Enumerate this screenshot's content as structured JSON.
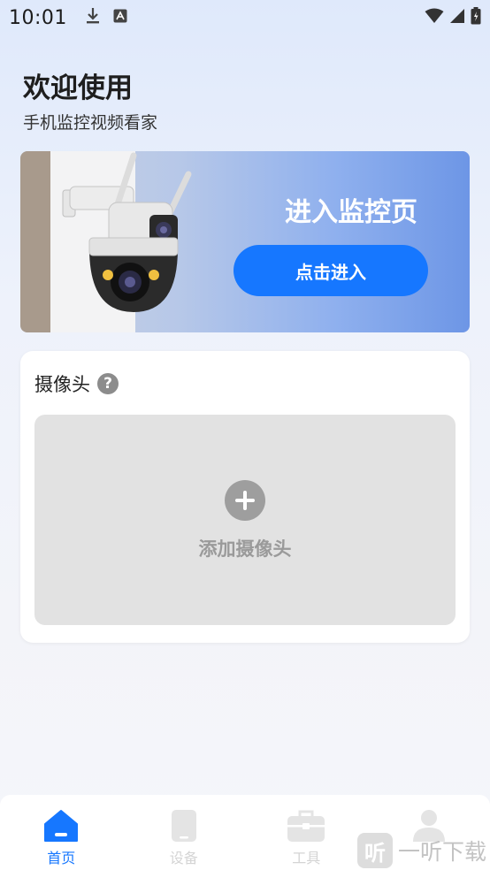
{
  "status_bar": {
    "time": "10:01",
    "left_icons": [
      "download-icon",
      "a-icon"
    ],
    "right_icons": [
      "wifi-icon",
      "signal-icon",
      "battery-icon"
    ]
  },
  "header": {
    "title": "欢迎使用",
    "subtitle": "手机监控视频看家"
  },
  "banner": {
    "title": "进入监控页",
    "button_label": "点击进入"
  },
  "camera_card": {
    "title": "摄像头",
    "help_glyph": "?",
    "add_label": "添加摄像头"
  },
  "bottom_nav": {
    "items": [
      {
        "label": "首页",
        "icon": "home-icon",
        "active": true
      },
      {
        "label": "设备",
        "icon": "phone-icon",
        "active": false
      },
      {
        "label": "工具",
        "icon": "toolbox-icon",
        "active": false
      },
      {
        "label": "",
        "icon": "user-icon",
        "active": false
      }
    ]
  },
  "watermark": {
    "glyph": "听",
    "text": "一听下载"
  },
  "colors": {
    "accent": "#1677ff",
    "nav_inactive": "#d4d4d4"
  }
}
